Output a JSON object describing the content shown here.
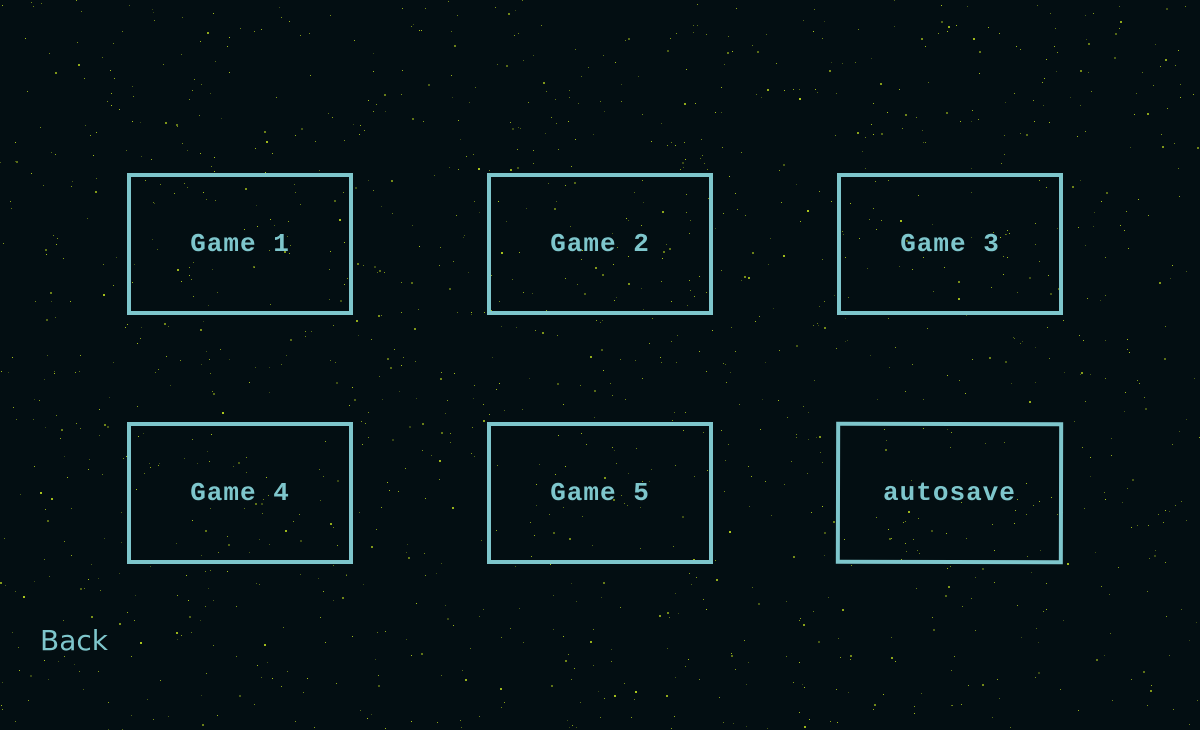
{
  "background": {
    "color": "#030e12",
    "star_color": "#c8e61e"
  },
  "accent_color": "#7ec6cc",
  "slots": [
    {
      "label": "Game 1"
    },
    {
      "label": "Game 2"
    },
    {
      "label": "Game 3"
    },
    {
      "label": "Game 4"
    },
    {
      "label": "Game 5"
    },
    {
      "label": "autosave"
    }
  ],
  "back_label": "Back"
}
